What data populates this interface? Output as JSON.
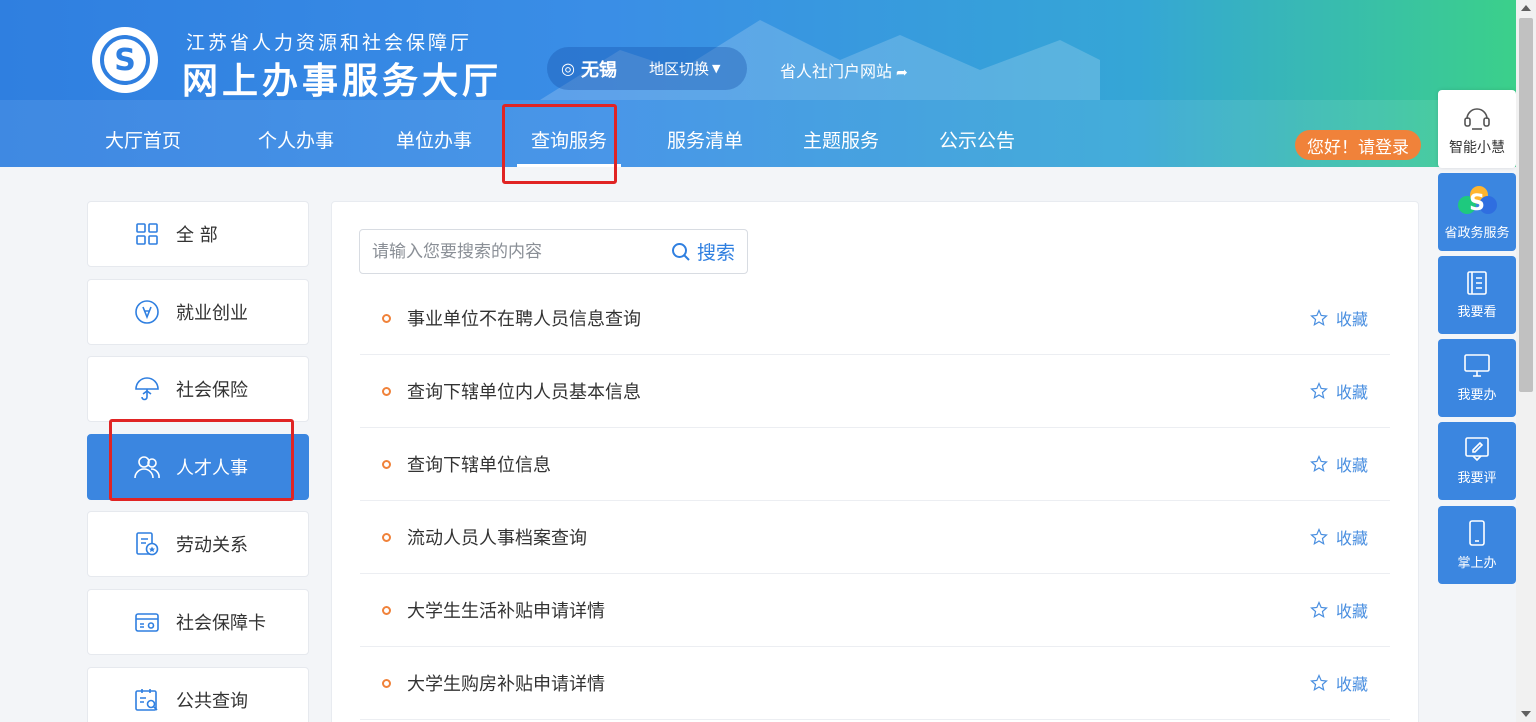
{
  "header": {
    "org_name": "江苏省人力资源和社会保障厅",
    "site_name": "网上办事服务大厅",
    "region": {
      "city": "无锡",
      "switch_label": "地区切换"
    },
    "portal_link": "省人社门户网站",
    "login_label": "您好！请登录"
  },
  "nav": [
    {
      "label": "大厅首页"
    },
    {
      "label": "个人办事"
    },
    {
      "label": "单位办事"
    },
    {
      "label": "查询服务",
      "active": true
    },
    {
      "label": "服务清单"
    },
    {
      "label": "主题服务"
    },
    {
      "label": "公示公告"
    }
  ],
  "sidebar": {
    "items": [
      {
        "label": "全 部",
        "icon": "grid-icon"
      },
      {
        "label": "就业创业",
        "icon": "employment-icon"
      },
      {
        "label": "社会保险",
        "icon": "umbrella-icon"
      },
      {
        "label": "人才人事",
        "icon": "people-icon",
        "active": true
      },
      {
        "label": "劳动关系",
        "icon": "labor-contract-icon"
      },
      {
        "label": "社会保障卡",
        "icon": "card-icon"
      },
      {
        "label": "公共查询",
        "icon": "query-icon"
      }
    ]
  },
  "search": {
    "placeholder": "请输入您要搜索的内容",
    "button_label": "搜索"
  },
  "list": {
    "fav_label": "收藏",
    "items": [
      {
        "title": "事业单位不在聘人员信息查询"
      },
      {
        "title": "查询下辖单位内人员基本信息"
      },
      {
        "title": "查询下辖单位信息"
      },
      {
        "title": "流动人员人事档案查询"
      },
      {
        "title": "大学生生活补贴申请详情"
      },
      {
        "title": "大学生购房补贴申请详情"
      }
    ]
  },
  "float_tools": {
    "assistant": "智能小慧",
    "gov_service": "省政务服务",
    "view": "我要看",
    "handle": "我要办",
    "review": "我要评",
    "mobile": "掌上办"
  },
  "colors": {
    "primary": "#3b86e0",
    "accent_orange": "#f0823a",
    "annotation_red": "#e02424"
  }
}
